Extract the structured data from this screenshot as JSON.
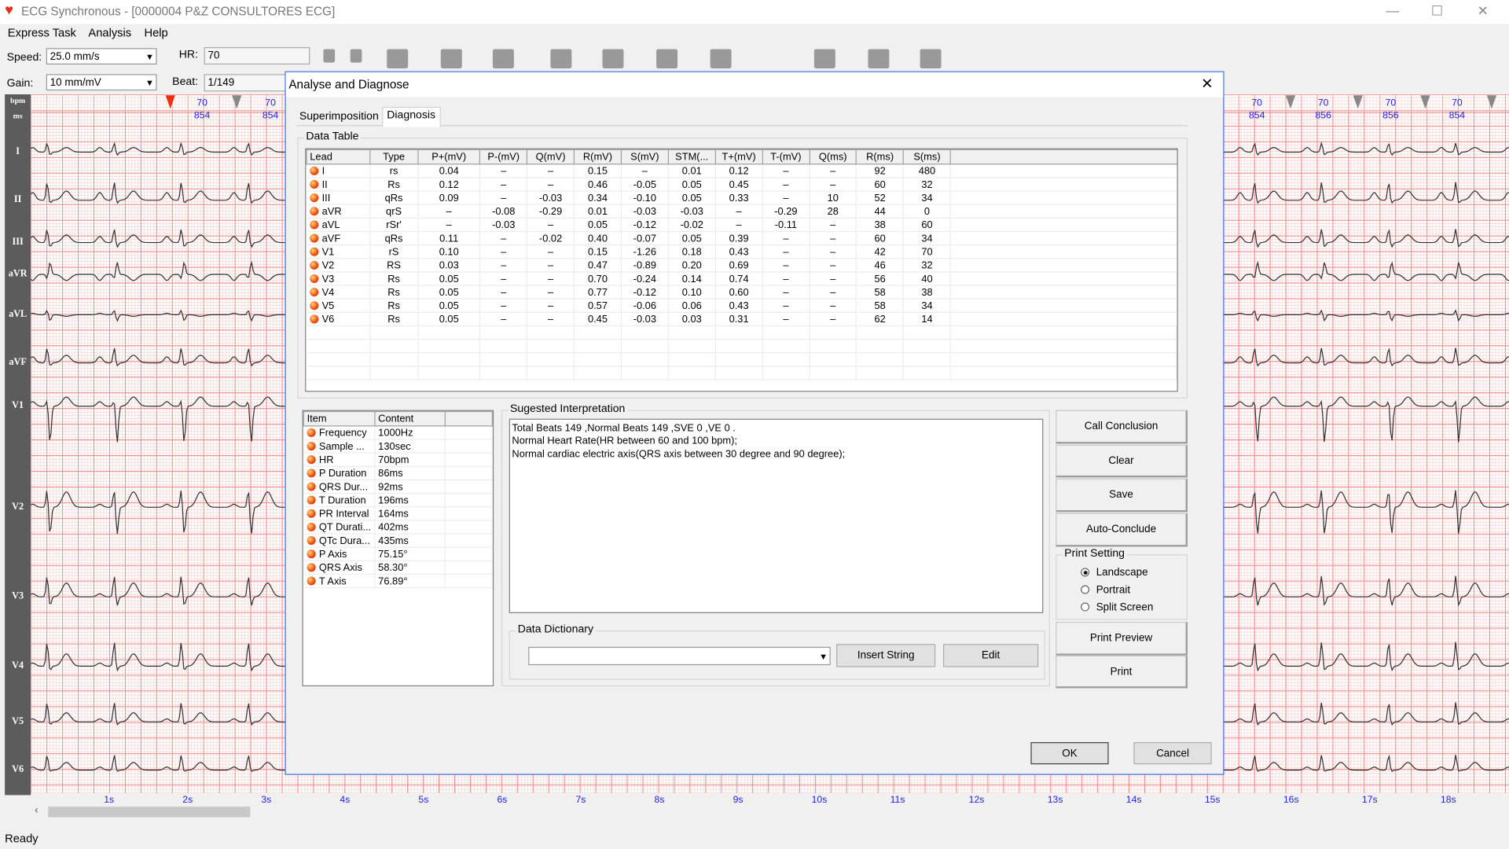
{
  "window": {
    "title": "ECG Synchronous - [0000004 P&Z CONSULTORES ECG]",
    "app_icon": "heart-icon"
  },
  "menu": [
    "Express Task",
    "Analysis",
    "Help"
  ],
  "toolbar": {
    "speed_label": "Speed:",
    "speed_value": "25.0 mm/s",
    "gain_label": "Gain:",
    "gain_value": "10 mm/mV",
    "hr_label": "HR:",
    "hr_value": "70",
    "beat_label": "Beat:",
    "beat_value": "1/149",
    "icons": [
      "page-first-icon",
      "page-prev-icon",
      "arrow-left-icon",
      "arrow-right-icon",
      "document-icon",
      "compass-icon",
      "folder-icon",
      "notes-icon",
      "eraser-icon",
      "refresh-icon",
      "shield-icon",
      "tag-icon"
    ]
  },
  "ecg": {
    "row_labels": [
      "bpm",
      "ms"
    ],
    "leads": [
      "I",
      "II",
      "III",
      "aVR",
      "aVL",
      "aVF",
      "V1",
      "V2",
      "V3",
      "V4",
      "V5",
      "V6"
    ],
    "beats_left": [
      {
        "bpm": "70",
        "ms": "854"
      },
      {
        "bpm": "70",
        "ms": "854"
      }
    ],
    "beats_right": [
      {
        "bpm": "70",
        "ms": "854"
      },
      {
        "bpm": "70",
        "ms": "856"
      },
      {
        "bpm": "70",
        "ms": "856"
      },
      {
        "bpm": "70",
        "ms": "854"
      }
    ],
    "time_ticks": [
      "1s",
      "2s",
      "3s",
      "4s",
      "5s",
      "6s",
      "7s",
      "8s",
      "9s",
      "10s",
      "11s",
      "12s",
      "13s",
      "14s",
      "15s",
      "16s",
      "17s",
      "18s"
    ],
    "colors": {
      "grid_major": "#f08c8c",
      "grid_minor": "#f9dede",
      "trace": "#333333",
      "marker_active": "#e83010"
    }
  },
  "status": "Ready",
  "dialog": {
    "title": "Analyse and Diagnose",
    "tabs": [
      "Superimposition",
      "Diagnosis"
    ],
    "active_tab": "Diagnosis",
    "data_table": {
      "title": "Data Table",
      "columns": [
        "Lead",
        "Type",
        "P+(mV)",
        "P-(mV)",
        "Q(mV)",
        "R(mV)",
        "S(mV)",
        "STM(...",
        "T+(mV)",
        "T-(mV)",
        "Q(ms)",
        "R(ms)",
        "S(ms)"
      ],
      "rows": [
        [
          "I",
          "rs",
          "0.04",
          "–",
          "–",
          "0.15",
          "–",
          "0.01",
          "0.12",
          "–",
          "–",
          "92",
          "480"
        ],
        [
          "II",
          "Rs",
          "0.12",
          "–",
          "–",
          "0.46",
          "-0.05",
          "0.05",
          "0.45",
          "–",
          "–",
          "60",
          "32"
        ],
        [
          "III",
          "qRs",
          "0.09",
          "–",
          "-0.03",
          "0.34",
          "-0.10",
          "0.05",
          "0.33",
          "–",
          "10",
          "52",
          "34"
        ],
        [
          "aVR",
          "qrS",
          "–",
          "-0.08",
          "-0.29",
          "0.01",
          "-0.03",
          "-0.03",
          "–",
          "-0.29",
          "28",
          "44",
          "0"
        ],
        [
          "aVL",
          "rSr'",
          "–",
          "-0.03",
          "–",
          "0.05",
          "-0.12",
          "-0.02",
          "–",
          "-0.11",
          "–",
          "38",
          "60"
        ],
        [
          "aVF",
          "qRs",
          "0.11",
          "–",
          "-0.02",
          "0.40",
          "-0.07",
          "0.05",
          "0.39",
          "–",
          "–",
          "60",
          "34"
        ],
        [
          "V1",
          "rS",
          "0.10",
          "–",
          "–",
          "0.15",
          "-1.26",
          "0.18",
          "0.43",
          "–",
          "–",
          "42",
          "70"
        ],
        [
          "V2",
          "RS",
          "0.03",
          "–",
          "–",
          "0.47",
          "-0.89",
          "0.20",
          "0.69",
          "–",
          "–",
          "46",
          "32"
        ],
        [
          "V3",
          "Rs",
          "0.05",
          "–",
          "–",
          "0.70",
          "-0.24",
          "0.14",
          "0.74",
          "–",
          "–",
          "56",
          "40"
        ],
        [
          "V4",
          "Rs",
          "0.05",
          "–",
          "–",
          "0.77",
          "-0.12",
          "0.10",
          "0.60",
          "–",
          "–",
          "58",
          "38"
        ],
        [
          "V5",
          "Rs",
          "0.05",
          "–",
          "–",
          "0.57",
          "-0.06",
          "0.06",
          "0.43",
          "–",
          "–",
          "58",
          "34"
        ],
        [
          "V6",
          "Rs",
          "0.05",
          "–",
          "–",
          "0.45",
          "-0.03",
          "0.03",
          "0.31",
          "–",
          "–",
          "62",
          "14"
        ]
      ]
    },
    "params": {
      "columns": [
        "Item",
        "Content"
      ],
      "rows": [
        [
          "Frequency",
          "1000Hz"
        ],
        [
          "Sample ...",
          "130sec"
        ],
        [
          "HR",
          "70bpm"
        ],
        [
          "P Duration",
          "86ms"
        ],
        [
          "QRS Dur...",
          "92ms"
        ],
        [
          "T Duration",
          "196ms"
        ],
        [
          "PR Interval",
          "164ms"
        ],
        [
          "QT Durati...",
          "402ms"
        ],
        [
          "QTc Dura...",
          "435ms"
        ],
        [
          "P Axis",
          "75.15°"
        ],
        [
          "QRS Axis",
          "58.30°"
        ],
        [
          "T Axis",
          "76.89°"
        ]
      ]
    },
    "interpretation": {
      "title": "Sugested Interpretation",
      "lines": [
        "Total Beats 149 ,Normal Beats 149 ,SVE 0 ,VE  0 .",
        "Normal Heart Rate(HR between 60 and 100 bpm);",
        "Normal cardiac electric axis(QRS axis between 30 degree and 90 degree);"
      ]
    },
    "dictionary": {
      "title": "Data Dictionary",
      "value": "",
      "insert_label": "Insert String",
      "edit_label": "Edit"
    },
    "buttons": {
      "call_conclusion": "Call Conclusion",
      "clear": "Clear",
      "save": "Save",
      "auto_conclude": "Auto-Conclude",
      "print_preview": "Print Preview",
      "print": "Print",
      "ok": "OK",
      "cancel": "Cancel"
    },
    "print_setting": {
      "title": "Print Setting",
      "options": [
        "Landscape",
        "Portrait",
        "Split Screen"
      ],
      "selected": "Landscape"
    }
  }
}
